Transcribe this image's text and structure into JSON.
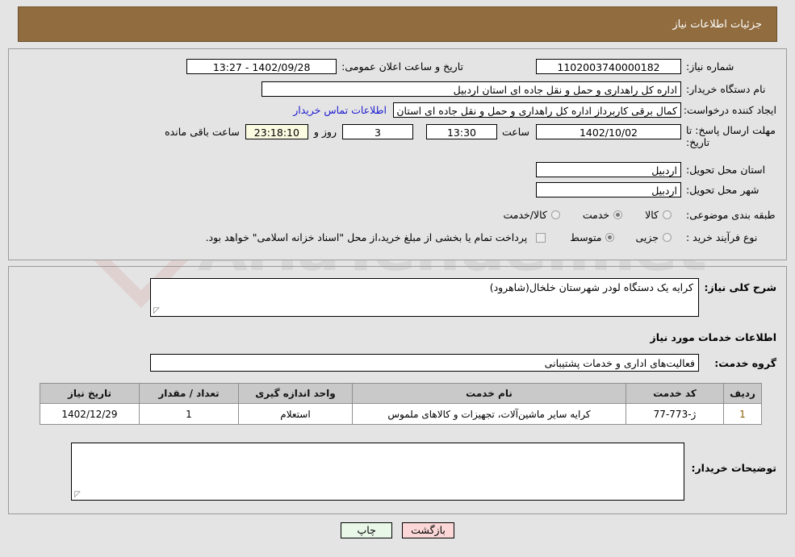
{
  "header": {
    "title": "جزئیات اطلاعات نیاز"
  },
  "form": {
    "need_number_label": "شماره نیاز:",
    "need_number_value": "1102003740000182",
    "announce_label": "تاریخ و ساعت اعلان عمومی:",
    "announce_value": "1402/09/28 - 13:27",
    "buyer_org_label": "نام دستگاه خریدار:",
    "buyer_org_value": "اداره کل راهداری و حمل و نقل جاده ای استان اردبیل",
    "creator_label": "ایجاد کننده درخواست:",
    "creator_value": "کمال برقی کاربرداز اداره کل راهداری و حمل و نقل جاده ای استان اردبیل",
    "contact_link": "اطلاعات تماس خریدار",
    "deadline_label": "مهلت ارسال پاسخ: تا تاریخ:",
    "deadline_date": "1402/10/02",
    "time_label": "ساعت",
    "deadline_time": "13:30",
    "days_value": "3",
    "days_sep_label": "روز و",
    "countdown_value": "23:18:10",
    "remaining_label": "ساعت باقی مانده",
    "province_label": "استان محل تحویل:",
    "province_value": "اردبیل",
    "city_label": "شهر محل تحویل:",
    "city_value": "اردبیل",
    "category_label": "طبقه بندی موضوعی:",
    "category_options": [
      {
        "label": "کالا",
        "selected": false
      },
      {
        "label": "خدمت",
        "selected": true
      },
      {
        "label": "کالا/خدمت",
        "selected": false
      }
    ],
    "process_label": "نوع فرآیند خرید :",
    "process_options": [
      {
        "label": "جزیی",
        "selected": false
      },
      {
        "label": "متوسط",
        "selected": true
      }
    ],
    "treasury_checked": false,
    "treasury_note": "پرداخت تمام یا بخشی از مبلغ خرید،از محل \"اسناد خزانه اسلامی\" خواهد بود."
  },
  "middle": {
    "general_desc_label": "شرح کلی نیاز:",
    "general_desc_value": "کرایه یک دستگاه لودر  شهرستان خلخال(شاهرود)",
    "services_section_title": "اطلاعات خدمات مورد نیاز",
    "service_group_label": "گروه خدمت:",
    "service_group_value": "فعالیت‌های اداری و خدمات پشتیبانی",
    "buyer_notes_label": "توضیحات خریدار:",
    "buyer_notes_value": ""
  },
  "table": {
    "columns": [
      "ردیف",
      "کد خدمت",
      "نام خدمت",
      "واحد اندازه گیری",
      "تعداد / مقدار",
      "تاریخ نیاز"
    ],
    "rows": [
      {
        "row_no": "1",
        "service_code": "ژ-773-77",
        "service_name": "کرایه سایر ماشین‌آلات، تجهیزات و کالاهای ملموس",
        "unit": "استعلام",
        "quantity": "1",
        "need_date": "1402/12/29"
      }
    ]
  },
  "buttons": {
    "print": "چاپ",
    "back": "بازگشت"
  },
  "watermark": {
    "text": "AriaTender.net"
  },
  "colors": {
    "header_brown": "#916c3f",
    "link_blue": "#1b1bd0",
    "countdown_bg": "#fbfbe2",
    "print_btn": "#e9f7e9",
    "back_btn": "#fbd7d7"
  }
}
